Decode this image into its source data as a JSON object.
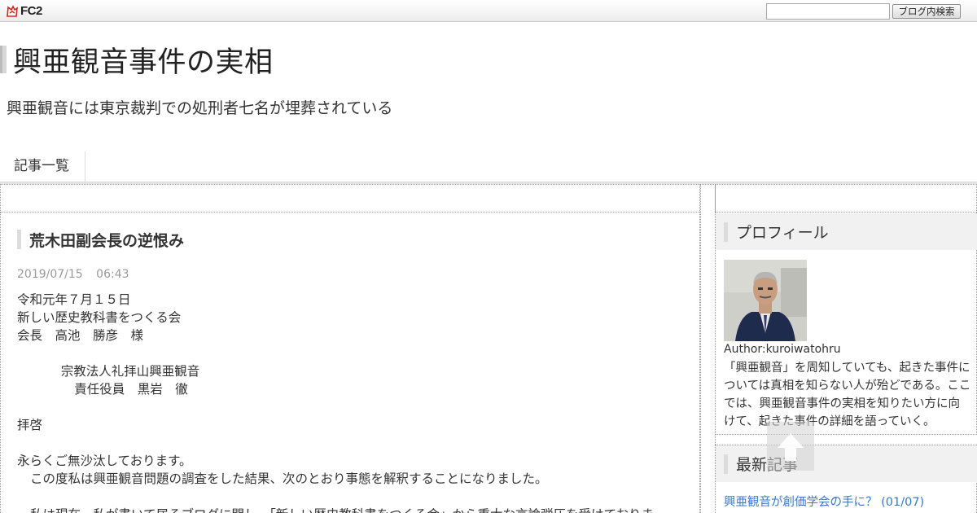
{
  "fc2": {
    "logo_text": "FC2",
    "search_placeholder": "",
    "search_button_label": "ブログ内検索"
  },
  "header": {
    "title": "興亜観音事件の実相",
    "description": "興亜観音には東京裁判での処刑者七名が埋葬されている"
  },
  "nav": {
    "items": [
      {
        "label": "記事一覧"
      }
    ]
  },
  "entry": {
    "title": "荒木田副会長の逆恨み",
    "date": "2019/07/15",
    "time": "06:43",
    "lines": {
      "l1": "令和元年７月１５日",
      "l2": "新しい歴史教科書をつくる会",
      "l3": "会長　高池　勝彦　様",
      "l4": "宗教法人礼拝山興亜観音",
      "l5": "責任役員　黒岩　徹",
      "l6": "拝啓",
      "l7": "永らくご無沙汰しております。",
      "l8": "この度私は興亜観音問題の調査をした結果、次のとおり事態を解釈することになりました。",
      "l9": "私は現在、私が書いて居るブログに関し、「新しい歴史教科書をつくる会」から重大な言論弾圧を受けておりま"
    }
  },
  "sidebar": {
    "profile": {
      "heading": "プロフィール",
      "author": "Author:kuroiwatohru",
      "text": "「興亜観音」を周知していても、起きた事件については真相を知らない人が殆どである。ここでは、興亜観音事件の実相を知りたい方に向けて、起きた事件の詳細を語っていく。"
    },
    "latest": {
      "heading": "最新記事",
      "items": [
        {
          "label": "興亜観音が創価学会の手に？ (01/07)"
        }
      ]
    }
  },
  "colors": {
    "link": "#3a79c6",
    "date": "#999999",
    "heading_bg": "#f1f1f1"
  }
}
